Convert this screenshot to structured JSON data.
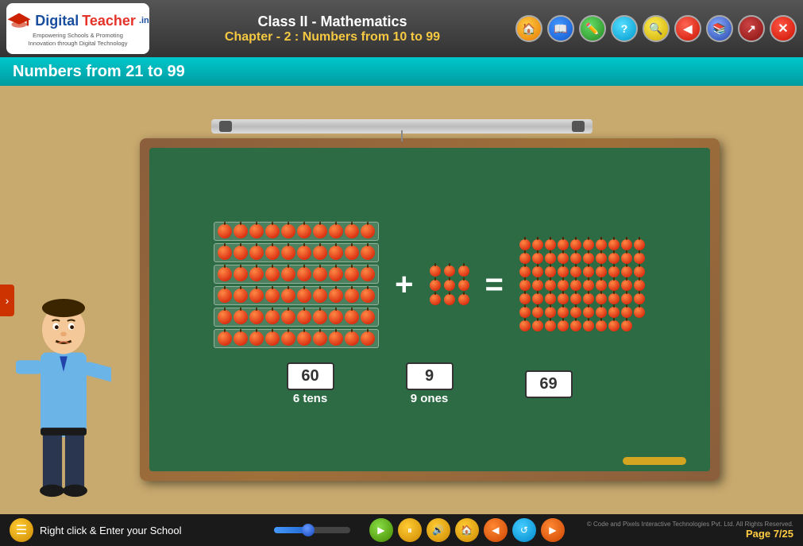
{
  "header": {
    "title_main": "Class II - Mathematics",
    "title_sub": "Chapter - 2 : Numbers from 10 to 99",
    "logo": {
      "text_digital": "Digital",
      "text_teacher": "Teacher",
      "text_in": ".in",
      "tagline_line1": "Empowering Schools & Promoting",
      "tagline_line2": "Innovation through Digital Technology"
    },
    "buttons": [
      {
        "id": "btn-home",
        "icon": "🏠",
        "class": "btn-orange"
      },
      {
        "id": "btn-book",
        "icon": "📖",
        "class": "btn-blue"
      },
      {
        "id": "btn-notes",
        "icon": "✏️",
        "class": "btn-green"
      },
      {
        "id": "btn-help",
        "icon": "?",
        "class": "btn-ltblue"
      },
      {
        "id": "btn-search",
        "icon": "🔍",
        "class": "btn-yellow"
      },
      {
        "id": "btn-prev-content",
        "icon": "◀",
        "class": "btn-red"
      },
      {
        "id": "btn-library",
        "icon": "📚",
        "class": "btn-book"
      },
      {
        "id": "btn-share",
        "icon": "↗",
        "class": "btn-maroon"
      },
      {
        "id": "btn-close",
        "icon": "✕",
        "class": "btn-close"
      }
    ]
  },
  "subtitle": {
    "text": "Numbers from 21 to 99"
  },
  "board": {
    "tens_count": 6,
    "ones_count": 9,
    "result": 69,
    "tens_label": "6 tens",
    "ones_label": "9 ones",
    "apples_per_row": 10
  },
  "footer": {
    "right_click_text": "Right click & Enter your School",
    "copyright": "© Code and Pixels Interactive Technologies Pvt. Ltd. All Rights Reserved.",
    "page_current": 7,
    "page_total": 25,
    "page_label": "Page"
  }
}
